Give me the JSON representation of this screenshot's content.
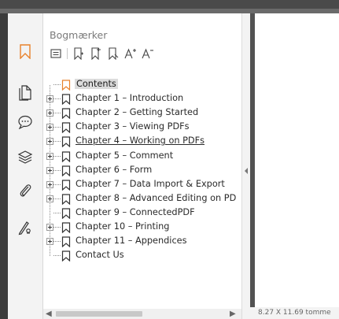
{
  "panel": {
    "title": "Bogmærker"
  },
  "toolbar": {
    "items": [
      "options-icon",
      "add-bookmark-icon",
      "add-child-bookmark-icon",
      "delete-bookmark-icon",
      "increase-text-size-icon",
      "decrease-text-size-icon"
    ]
  },
  "sidebar": {
    "items": [
      "bookmarks-icon",
      "pages-icon",
      "comments-icon",
      "layers-icon",
      "attachments-icon",
      "signatures-icon"
    ],
    "active": "bookmarks-icon",
    "accent": "#e8812a"
  },
  "bookmarks": [
    {
      "label": "Contents",
      "selected": true,
      "expandable": false
    },
    {
      "label": "Chapter 1 – Introduction",
      "expandable": true
    },
    {
      "label": "Chapter 2 – Getting Started",
      "expandable": true
    },
    {
      "label": "Chapter 3 – Viewing PDFs",
      "expandable": true
    },
    {
      "label": "Chapter 4 – Working on PDFs",
      "expandable": true,
      "underlined": true
    },
    {
      "label": "Chapter 5 – Comment",
      "expandable": true
    },
    {
      "label": "Chapter 6 – Form",
      "expandable": true
    },
    {
      "label": "Chapter 7 – Data Import & Export",
      "expandable": true
    },
    {
      "label": "Chapter 8 – Advanced Editing on PD",
      "expandable": true
    },
    {
      "label": "Chapter 9 – ConnectedPDF",
      "expandable": false
    },
    {
      "label": "Chapter 10 – Printing",
      "expandable": true
    },
    {
      "label": "Chapter 11 – Appendices",
      "expandable": true
    },
    {
      "label": "Contact Us",
      "expandable": false
    }
  ],
  "status": {
    "page_size": "8.27 X 11.69 tomme"
  }
}
